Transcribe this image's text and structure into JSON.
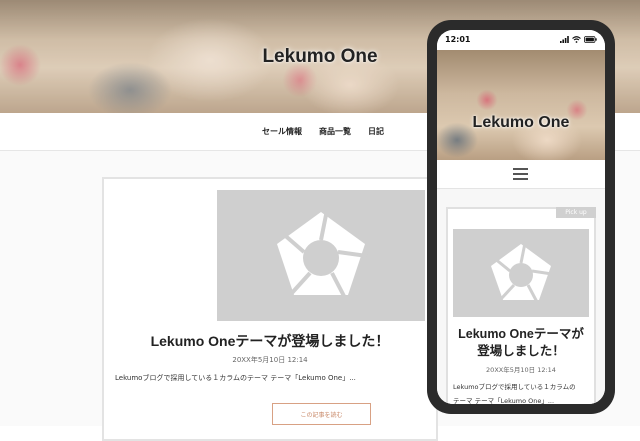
{
  "site": {
    "title": "Lekumo One"
  },
  "nav": {
    "items": [
      {
        "label": "セール情報"
      },
      {
        "label": "商品一覧"
      },
      {
        "label": "日記"
      }
    ]
  },
  "article": {
    "title": "Lekumo Oneテーマが登場しました！",
    "date": "20XX年5月10日 12:14",
    "excerpt": "Lekumoブログで採用している１カラムのテーマ テーマ「Lekumo One」...",
    "read_more": "この記事を読む"
  },
  "mobile": {
    "status_time": "12:01",
    "badge": "Pick up",
    "title_line1": "Lekumo Oneテーマが",
    "title_line2": "登場しました！",
    "excerpt_line1": "Lekumoブログで採用している１カラムの",
    "excerpt_line2": "テーマ テーマ「Lekumo One」..."
  },
  "icons": {
    "logo": "pentagon-ring-logo-icon",
    "menu": "hamburger-menu-icon",
    "signal": "signal-icon",
    "wifi": "wifi-icon",
    "battery": "battery-icon"
  },
  "colors": {
    "accent": "#c98a6a",
    "placeholder": "#cfcfcf",
    "phone_frame": "#2b2b2b"
  }
}
